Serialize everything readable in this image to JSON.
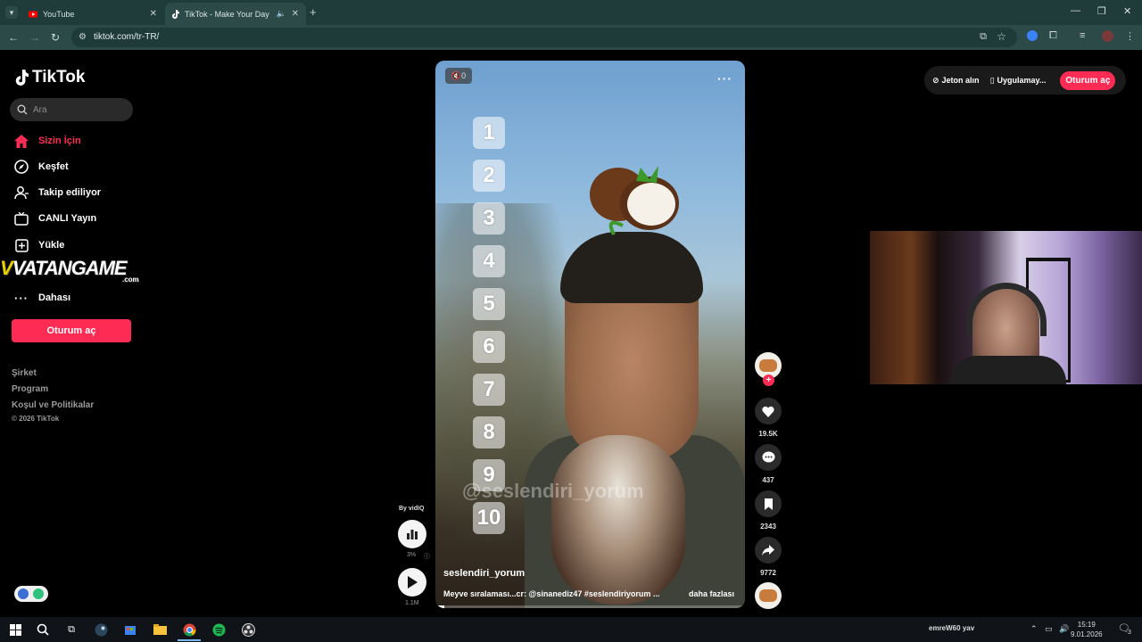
{
  "browser": {
    "tabs": [
      {
        "label": "YouTube",
        "active": false
      },
      {
        "label": "TikTok - Make Your Day",
        "active": true
      }
    ],
    "url": "tiktok.com/tr-TR/"
  },
  "tiktok": {
    "brand": "TikTok",
    "search_placeholder": "Ara",
    "nav": [
      {
        "label": "Sizin İçin",
        "icon": "home-icon",
        "active": true
      },
      {
        "label": "Keşfet",
        "icon": "compass-icon"
      },
      {
        "label": "Takip ediliyor",
        "icon": "following-icon"
      },
      {
        "label": "CANLI Yayın",
        "icon": "live-icon"
      },
      {
        "label": "Yükle",
        "icon": "upload-icon"
      },
      {
        "label": "Dahası",
        "icon": "more-icon"
      }
    ],
    "overlay_logo": {
      "text": "VATANGAME",
      "domain": ".com"
    },
    "login_label": "Oturum aç",
    "footer": [
      "Şirket",
      "Program",
      "Koşul ve Politikalar"
    ],
    "copyright": "© 2026 TikTok",
    "topbar": {
      "coins": "Jeton alın",
      "app": "Uygulamay...",
      "login": "Oturum aç"
    }
  },
  "video": {
    "mute_label": "0",
    "numbers": [
      "1",
      "2",
      "3",
      "4",
      "5",
      "6",
      "7",
      "8",
      "9",
      "10"
    ],
    "watermark": "@seslendiri_yorum",
    "author": "seslendiri_yorum",
    "description": "Meyve sıralaması...cr: @sinanediz47 #seslendiriyorum ...",
    "more_label": "daha fazlası",
    "progress_fraction": 0.03
  },
  "actions": {
    "likes": "19.5K",
    "comments": "437",
    "saves": "2343",
    "shares": "9772"
  },
  "vidiq": {
    "by_label": "By vidIQ",
    "percent": "3%",
    "views": "1.1M"
  },
  "taskbar": {
    "username": "emreW60",
    "lang": "yav",
    "time": "15:19",
    "date": "9.01.2026",
    "notif_count": "3"
  },
  "colors": {
    "accent": "#fe2c55",
    "chrome_bg": "#2b4a48"
  }
}
